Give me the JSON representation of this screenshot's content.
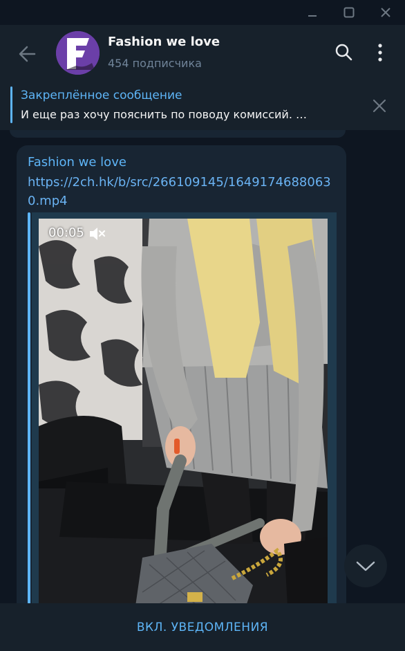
{
  "window": {
    "controls": [
      "minimize-icon",
      "maximize-icon",
      "close-icon"
    ]
  },
  "header": {
    "title": "Fashion we love",
    "subtitle": "454 подписчика",
    "avatar_letter": "F",
    "avatar_color": "#6b3fa8"
  },
  "pinned": {
    "title": "Закреплённое сообщение",
    "text": "И еще раз хочу пояснить по поводу комиссий.  …"
  },
  "message": {
    "author": "Fashion we love",
    "link": "https://2ch.hk/b/src/266109145/16491746880630.mp4",
    "video": {
      "duration": "00:05",
      "muted": true
    }
  },
  "bottom": {
    "action_label": "ВКЛ. УВЕДОМЛЕНИЯ"
  },
  "colors": {
    "background": "#0e1621",
    "panel": "#17212b",
    "bubble": "#182533",
    "accent": "#5eb5f7",
    "muted_text": "#708499"
  }
}
